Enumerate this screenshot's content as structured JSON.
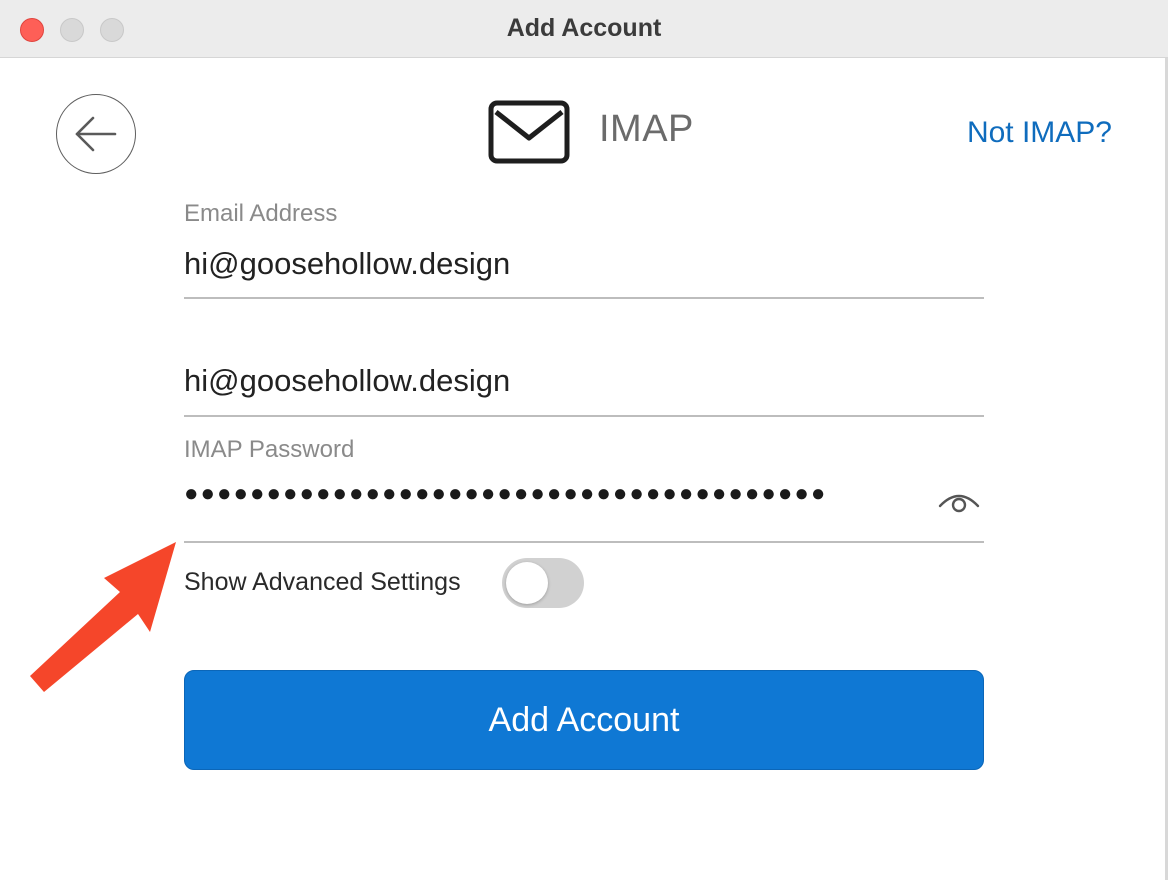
{
  "window": {
    "title": "Add Account"
  },
  "header": {
    "back_icon": "arrow-left-icon",
    "mail_icon": "envelope-icon",
    "title": "IMAP",
    "not_imap_link": "Not IMAP?"
  },
  "form": {
    "email": {
      "label": "Email Address",
      "value": "hi@goosehollow.design"
    },
    "username": {
      "value": "hi@goosehollow.design"
    },
    "password": {
      "label": "IMAP Password",
      "masked_value": "●●●●●●●●●●●●●●●●●●●●●●●●●●●●●●●●●●●●●●●",
      "reveal_icon": "eye-icon"
    },
    "advanced": {
      "label": "Show Advanced Settings",
      "enabled": false
    },
    "submit_label": "Add Account"
  },
  "colors": {
    "accent": "#0f78d4",
    "link": "#0f6cbd",
    "annotation_arrow": "#f5462a",
    "close_button": "#fe5f57"
  }
}
